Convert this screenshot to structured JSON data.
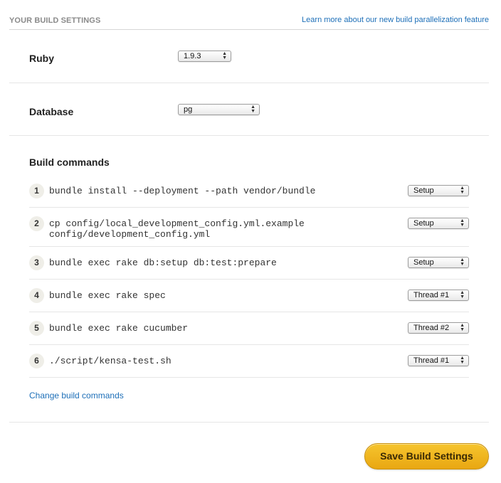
{
  "header": {
    "title": "YOUR BUILD SETTINGS",
    "learn_more_link": "Learn more about our new build parallelization feature"
  },
  "ruby": {
    "label": "Ruby",
    "selected": "1.9.3"
  },
  "database": {
    "label": "Database",
    "selected": "pg"
  },
  "build_commands": {
    "label": "Build commands",
    "items": [
      {
        "num": "1",
        "lines": [
          "bundle install --deployment --path vendor/bundle"
        ],
        "phase": "Setup"
      },
      {
        "num": "2",
        "lines": [
          "cp config/local_development_config.yml.example",
          "config/development_config.yml"
        ],
        "phase": "Setup"
      },
      {
        "num": "3",
        "lines": [
          "bundle exec rake db:setup db:test:prepare"
        ],
        "phase": "Setup"
      },
      {
        "num": "4",
        "lines": [
          "bundle exec rake spec"
        ],
        "phase": "Thread #1"
      },
      {
        "num": "5",
        "lines": [
          "bundle exec rake cucumber"
        ],
        "phase": "Thread #2"
      },
      {
        "num": "6",
        "lines": [
          "./script/kensa-test.sh"
        ],
        "phase": "Thread #1"
      }
    ],
    "change_link": "Change build commands"
  },
  "save_button": "Save Build Settings",
  "colors": {
    "link": "#1d6fb8",
    "save_button": "#f0b61f",
    "badge": "#efeee8"
  }
}
